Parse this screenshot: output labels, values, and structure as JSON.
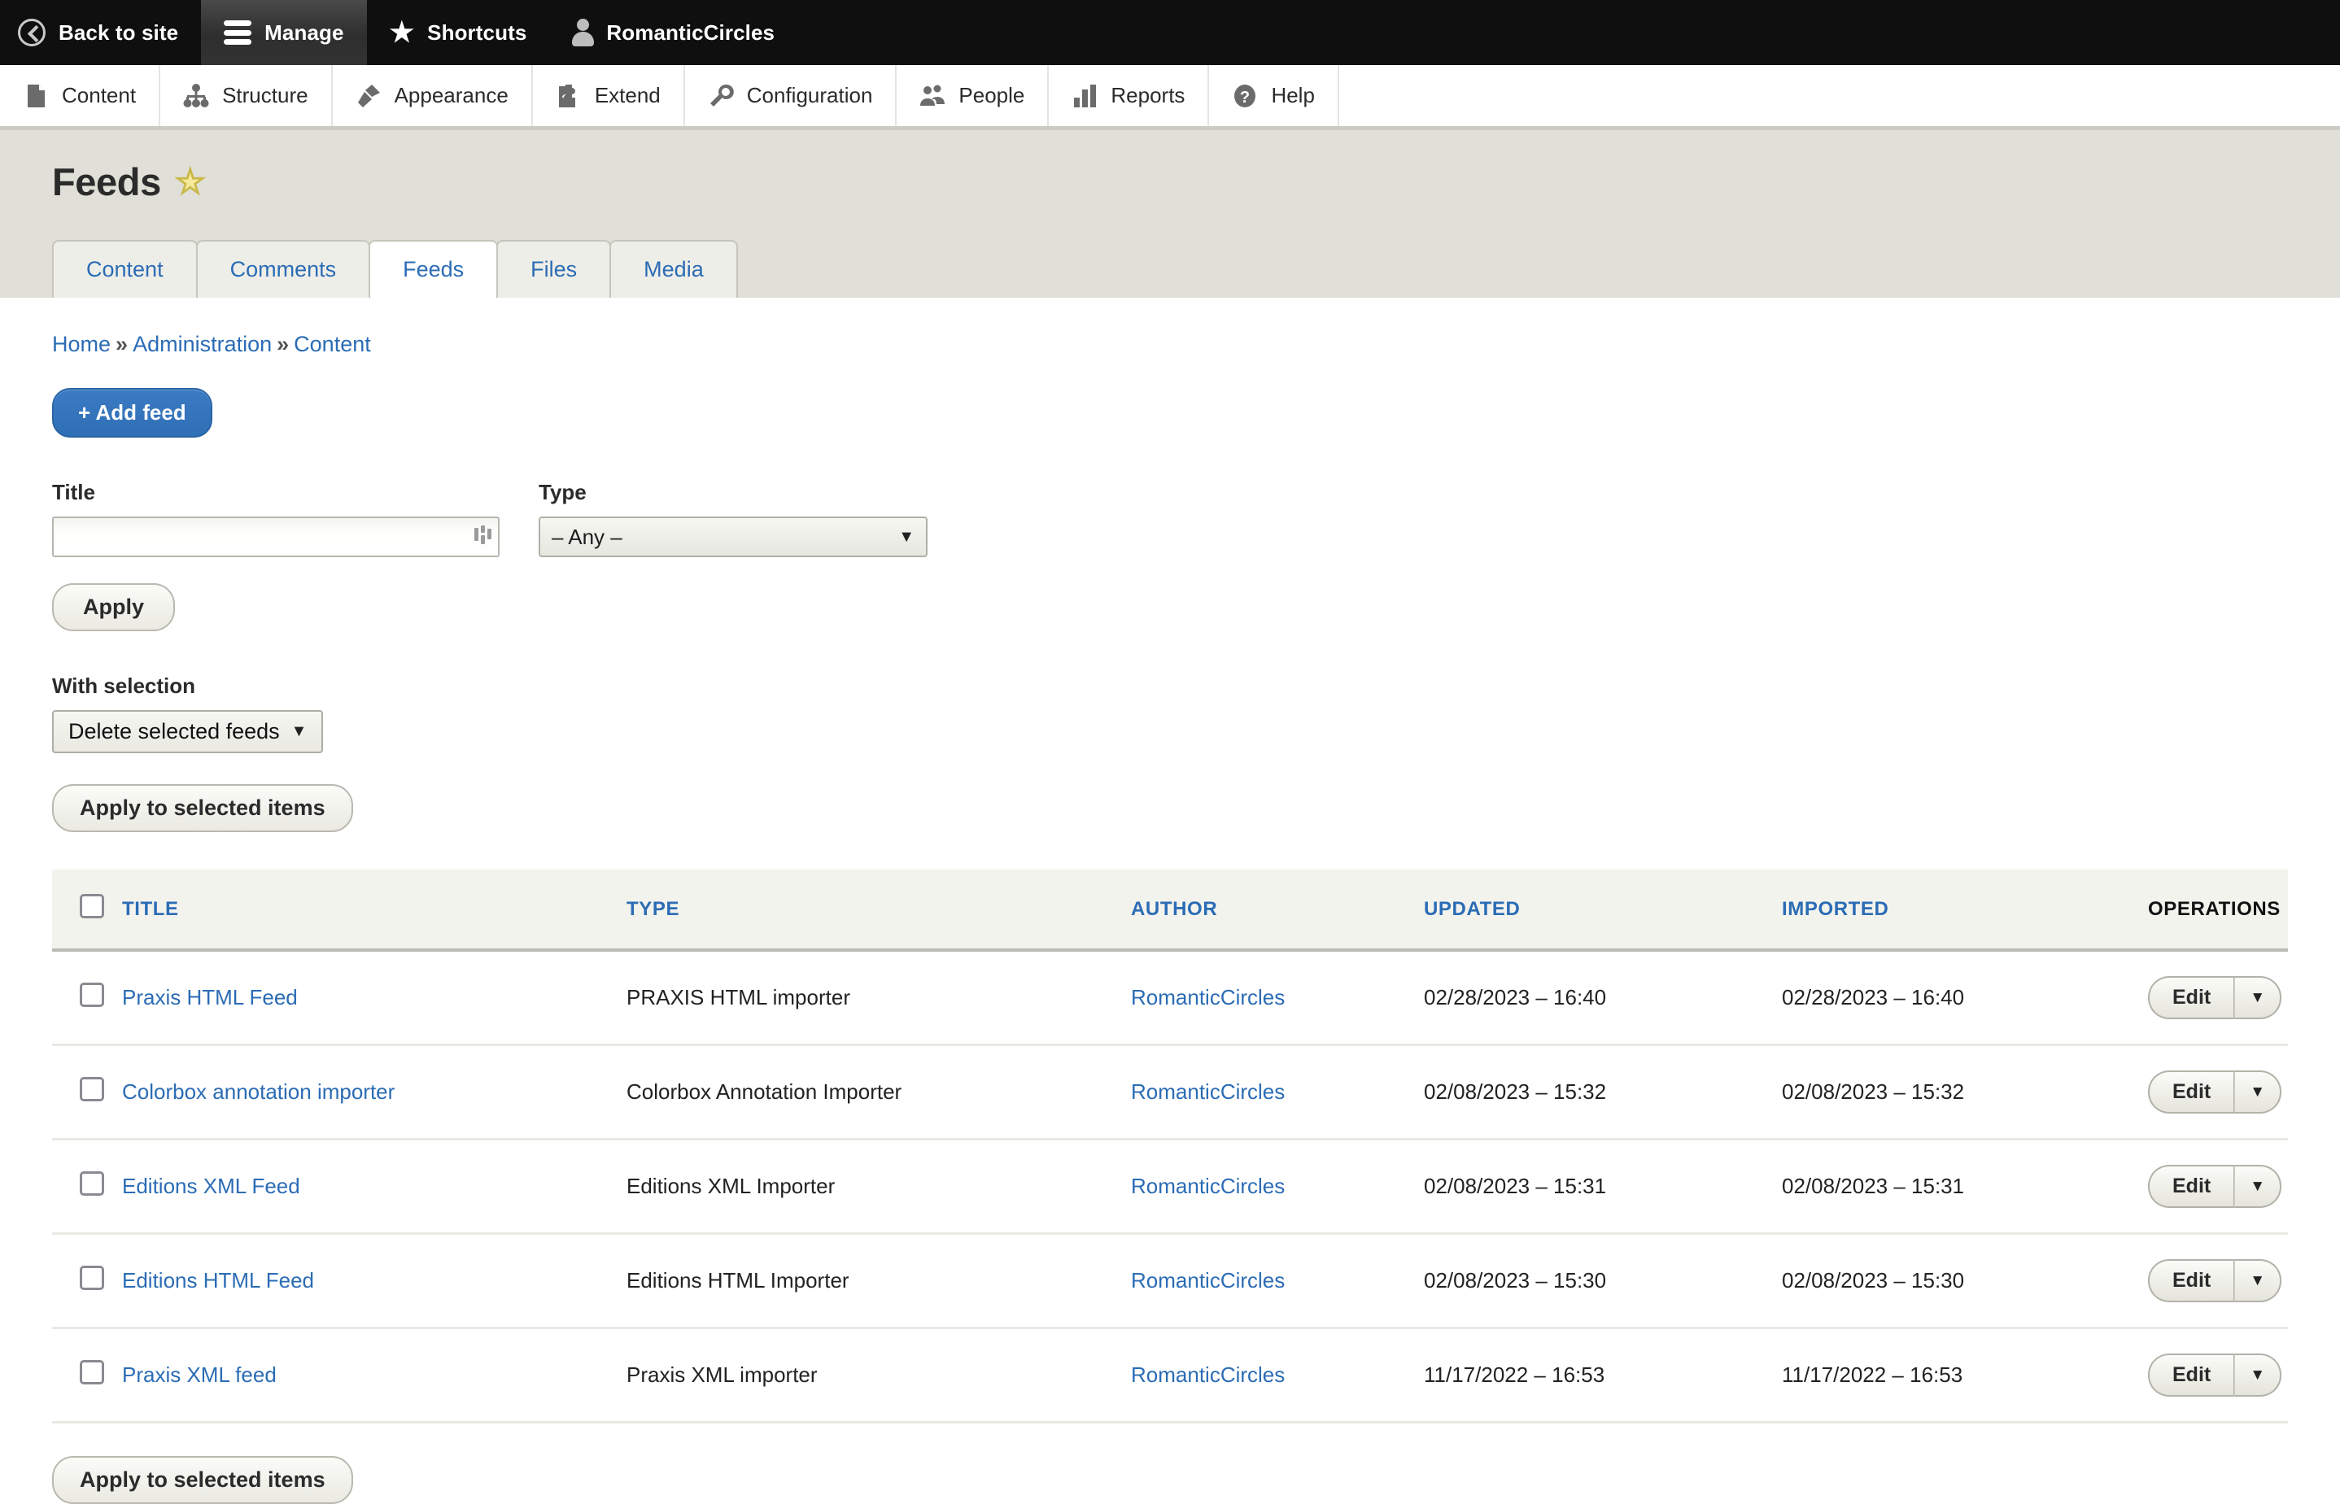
{
  "toolbar": {
    "back_to_site": "Back to site",
    "manage": "Manage",
    "shortcuts": "Shortcuts",
    "account": "RomanticCircles"
  },
  "menu": {
    "items": [
      {
        "label": "Content",
        "icon": "document-icon"
      },
      {
        "label": "Structure",
        "icon": "structure-icon"
      },
      {
        "label": "Appearance",
        "icon": "paintbrush-icon"
      },
      {
        "label": "Extend",
        "icon": "puzzle-icon"
      },
      {
        "label": "Configuration",
        "icon": "wrench-icon"
      },
      {
        "label": "People",
        "icon": "people-icon"
      },
      {
        "label": "Reports",
        "icon": "bar-chart-icon"
      },
      {
        "label": "Help",
        "icon": "question-icon"
      }
    ]
  },
  "page": {
    "title": "Feeds",
    "star": "★"
  },
  "tabs": [
    {
      "label": "Content",
      "active": false
    },
    {
      "label": "Comments",
      "active": false
    },
    {
      "label": "Feeds",
      "active": true
    },
    {
      "label": "Files",
      "active": false
    },
    {
      "label": "Media",
      "active": false
    }
  ],
  "breadcrumb": {
    "items": [
      "Home",
      "Administration",
      "Content"
    ],
    "separator": "»"
  },
  "actions": {
    "add_feed": "+ Add feed"
  },
  "filters": {
    "title_label": "Title",
    "title_value": "",
    "title_placeholder": "",
    "type_label": "Type",
    "type_value": "– Any –",
    "apply": "Apply"
  },
  "bulk": {
    "with_selection_label": "With selection",
    "action_value": "Delete selected feeds",
    "apply_button": "Apply to selected items",
    "apply_button_bottom": "Apply to selected items"
  },
  "table": {
    "columns": [
      "TITLE",
      "TYPE",
      "AUTHOR",
      "UPDATED",
      "IMPORTED",
      "OPERATIONS"
    ],
    "operations_label": "Edit",
    "rows": [
      {
        "title": "Praxis HTML Feed",
        "type": "PRAXIS HTML importer",
        "author": "RomanticCircles",
        "updated": "02/28/2023 – 16:40",
        "imported": "02/28/2023 – 16:40"
      },
      {
        "title": "Colorbox annotation importer",
        "type": "Colorbox Annotation Importer",
        "author": "RomanticCircles",
        "updated": "02/08/2023 – 15:32",
        "imported": "02/08/2023 – 15:32"
      },
      {
        "title": "Editions XML Feed",
        "type": "Editions XML Importer",
        "author": "RomanticCircles",
        "updated": "02/08/2023 – 15:31",
        "imported": "02/08/2023 – 15:31"
      },
      {
        "title": "Editions HTML Feed",
        "type": "Editions HTML Importer",
        "author": "RomanticCircles",
        "updated": "02/08/2023 – 15:30",
        "imported": "02/08/2023 – 15:30"
      },
      {
        "title": "Praxis XML feed",
        "type": "Praxis XML importer",
        "author": "RomanticCircles",
        "updated": "11/17/2022 – 16:53",
        "imported": "11/17/2022 – 16:53"
      }
    ]
  },
  "colors": {
    "toolbar_bg": "#0f0f0f",
    "link_blue": "#2b6cb5",
    "button_blue": "#2f6fb5",
    "band_bg": "#e0e0d8",
    "table_header_bg": "#f3f3ee"
  }
}
